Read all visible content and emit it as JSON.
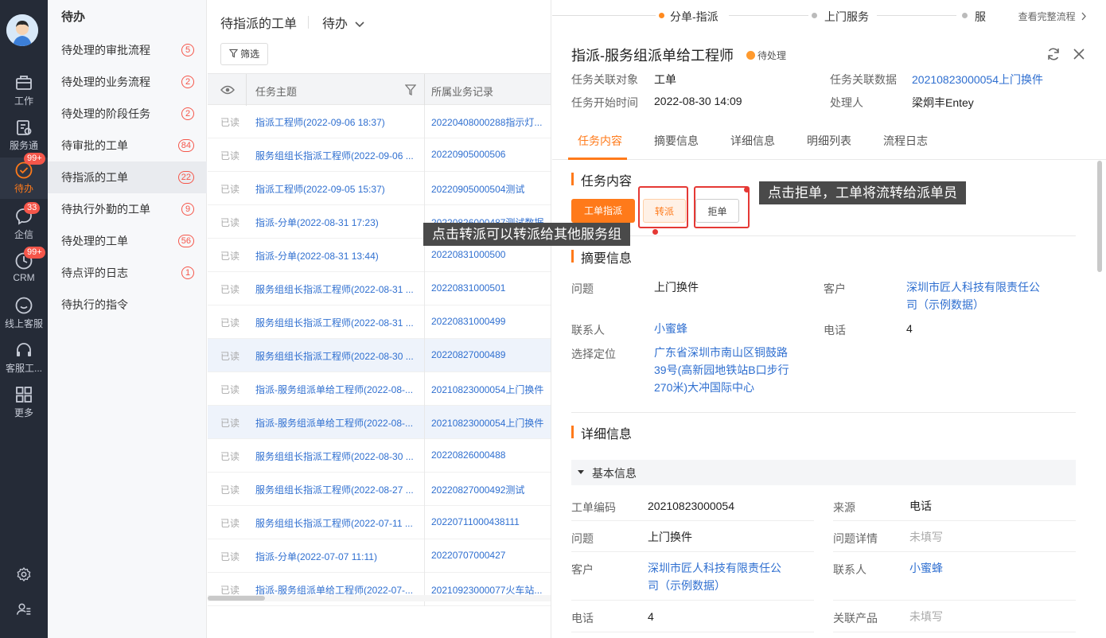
{
  "rail": {
    "items": [
      {
        "label": "工作",
        "icon": "briefcase-icon"
      },
      {
        "label": "服务通",
        "icon": "clipboard-icon"
      },
      {
        "label": "待办",
        "icon": "check-circle-icon",
        "badge": "99+"
      },
      {
        "label": "企信",
        "icon": "chat-bubble-icon",
        "badge": "33"
      },
      {
        "label": "CRM",
        "icon": "clock-icon",
        "badge": "99+"
      },
      {
        "label": "线上客服",
        "icon": "smile-chat-icon"
      },
      {
        "label": "客服工...",
        "icon": "headset-icon"
      },
      {
        "label": "更多",
        "icon": "grid-icon"
      }
    ],
    "bottom_icons": [
      "gear-icon",
      "user-list-icon"
    ]
  },
  "todo": {
    "title": "待办",
    "items": [
      {
        "label": "待处理的审批流程",
        "count": "5"
      },
      {
        "label": "待处理的业务流程",
        "count": "2"
      },
      {
        "label": "待处理的阶段任务",
        "count": "2"
      },
      {
        "label": "待审批的工单",
        "count": "84"
      },
      {
        "label": "待指派的工单",
        "count": "22"
      },
      {
        "label": "待执行外勤的工单",
        "count": "9"
      },
      {
        "label": "待处理的工单",
        "count": "56"
      },
      {
        "label": "待点评的日志",
        "count": "1"
      },
      {
        "label": "待执行的指令",
        "count": ""
      }
    ]
  },
  "list": {
    "title": "待指派的工单",
    "mode": "待办",
    "filter_label": "筛选",
    "columns": {
      "subject": "任务主题",
      "record": "所属业务记录"
    },
    "rows": [
      {
        "read": "已读",
        "subject": "指派工程师(2022-09-06 18:37)",
        "record": "20220408000288指示灯..."
      },
      {
        "read": "已读",
        "subject": "服务组组长指派工程师(2022-09-06 ...",
        "record": "20220905000506"
      },
      {
        "read": "已读",
        "subject": "指派工程师(2022-09-05 15:37)",
        "record": "20220905000504测试"
      },
      {
        "read": "已读",
        "subject": "指派-分单(2022-08-31 17:23)",
        "record": "20220826000487测试数据"
      },
      {
        "read": "已读",
        "subject": "指派-分单(2022-08-31 13:44)",
        "record": "20220831000500"
      },
      {
        "read": "已读",
        "subject": "服务组组长指派工程师(2022-08-31 ...",
        "record": "20220831000501"
      },
      {
        "read": "已读",
        "subject": "服务组组长指派工程师(2022-08-31 ...",
        "record": "20220831000499"
      },
      {
        "read": "已读",
        "subject": "服务组组长指派工程师(2022-08-30 ...",
        "record": "20220827000489"
      },
      {
        "read": "已读",
        "subject": "指派-服务组派单给工程师(2022-08-...",
        "record": "20210823000054上门换件"
      },
      {
        "read": "已读",
        "subject": "指派-服务组派单给工程师(2022-08-...",
        "record": "20210823000054上门换件"
      },
      {
        "read": "已读",
        "subject": "服务组组长指派工程师(2022-08-30 ...",
        "record": "20220826000488"
      },
      {
        "read": "已读",
        "subject": "服务组组长指派工程师(2022-08-27 ...",
        "record": "20220827000492测试"
      },
      {
        "read": "已读",
        "subject": "服务组组长指派工程师(2022-07-11 ...",
        "record": "20220711000438111"
      },
      {
        "read": "已读",
        "subject": "指派-分单(2022-07-07 11:11)",
        "record": "20220707000427"
      },
      {
        "read": "已读",
        "subject": "指派-服务组派单给工程师(2022-07-...",
        "record": "20210923000077火车站..."
      }
    ]
  },
  "detail": {
    "steps": [
      "分单-指派",
      "上门服务",
      "服"
    ],
    "view_flow": "查看完整流程",
    "title": "指派-服务组派单给工程师",
    "status": "待处理",
    "meta": {
      "obj_label": "任务关联对象",
      "obj_value": "工单",
      "data_label": "任务关联数据",
      "data_value": "20210823000054上门换件",
      "start_label": "任务开始时间",
      "start_value": "2022-08-30 14:09",
      "handler_label": "处理人",
      "handler_value": "梁炯丰Entey"
    },
    "tabs": [
      "任务内容",
      "摘要信息",
      "详细信息",
      "明细列表",
      "流程日志"
    ],
    "task_section": "任务内容",
    "buttons": {
      "assign": "工单指派",
      "transfer": "转派",
      "reject": "拒单"
    },
    "tips": {
      "reject": "点击拒单，工单将流转给派单员",
      "transfer": "点击转派可以转派给其他服务组"
    },
    "summary": {
      "title": "摘要信息",
      "issue_label": "问题",
      "issue_value": "上门换件",
      "customer_label": "客户",
      "customer_value": "深圳市匠人科技有限责任公司（示例数据）",
      "contact_label": "联系人",
      "contact_value": "小蜜蜂",
      "phone_label": "电话",
      "phone_value": "4",
      "location_label": "选择定位",
      "location_value": "广东省深圳市南山区铜鼓路39号(高新园地铁站B口步行270米)大冲国际中心"
    },
    "details": {
      "title": "详细信息",
      "group": "基本信息",
      "code_label": "工单编码",
      "code_value": "20210823000054",
      "source_label": "来源",
      "source_value": "电话",
      "issue_label": "问题",
      "issue_value": "上门换件",
      "issue_detail_label": "问题详情",
      "issue_detail_value": "未填写",
      "customer_label": "客户",
      "customer_value": "深圳市匠人科技有限责任公司（示例数据）",
      "contact_label": "联系人",
      "contact_value": "小蜜蜂",
      "phone_label": "电话",
      "phone_value": "4",
      "product_label": "关联产品",
      "product_value": "未填写"
    }
  },
  "colors": {
    "accent": "#ff7a1a",
    "link": "#2f6fd0",
    "rail": "#252b37",
    "badge": "#f5564a",
    "annotation": "#e53935"
  }
}
